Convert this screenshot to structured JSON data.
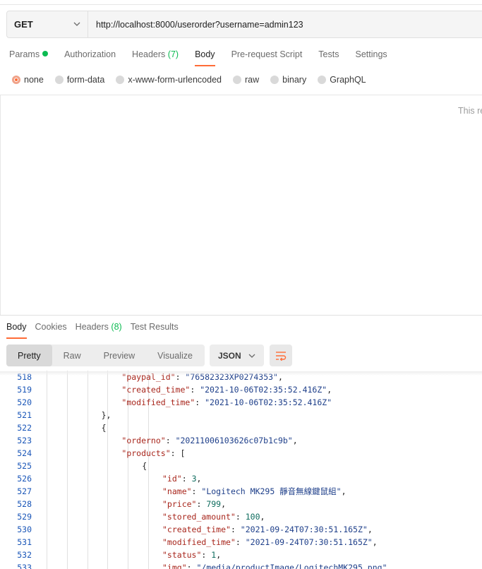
{
  "request": {
    "method": "GET",
    "url": "http://localhost:8000/userorder?username=admin123"
  },
  "request_tabs": [
    {
      "label": "Params",
      "dot": true
    },
    {
      "label": "Authorization"
    },
    {
      "label": "Headers",
      "count": "(7)"
    },
    {
      "label": "Body",
      "active": true
    },
    {
      "label": "Pre-request Script"
    },
    {
      "label": "Tests"
    },
    {
      "label": "Settings"
    }
  ],
  "body_types": [
    "none",
    "form-data",
    "x-www-form-urlencoded",
    "raw",
    "binary",
    "GraphQL"
  ],
  "selected_body_type": "none",
  "body_hint": "This re",
  "response_tabs": [
    {
      "label": "Body",
      "active": true
    },
    {
      "label": "Cookies"
    },
    {
      "label": "Headers",
      "count": "(8)"
    },
    {
      "label": "Test Results"
    }
  ],
  "view_modes": [
    "Pretty",
    "Raw",
    "Preview",
    "Visualize"
  ],
  "active_view": "Pretty",
  "format": "JSON",
  "colors": {
    "accent": "#ff6c37",
    "success": "#0cbb52",
    "key": "#a8261c",
    "string": "#1e3f8a",
    "number": "#0f6d5f",
    "line_number": "#1a56b8"
  },
  "code_lines": [
    {
      "n": "518",
      "indent": 4,
      "tokens": [
        [
          "k",
          "\"paypal_id\""
        ],
        [
          "p",
          ": "
        ],
        [
          "s",
          "\"76582323XP0274353\""
        ],
        [
          "p",
          ","
        ]
      ]
    },
    {
      "n": "519",
      "indent": 4,
      "tokens": [
        [
          "k",
          "\"created_time\""
        ],
        [
          "p",
          ": "
        ],
        [
          "s",
          "\"2021-10-06T02:35:52.416Z\""
        ],
        [
          "p",
          ","
        ]
      ]
    },
    {
      "n": "520",
      "indent": 4,
      "tokens": [
        [
          "k",
          "\"modified_time\""
        ],
        [
          "p",
          ": "
        ],
        [
          "s",
          "\"2021-10-06T02:35:52.416Z\""
        ]
      ]
    },
    {
      "n": "521",
      "indent": 3,
      "tokens": [
        [
          "p",
          "},"
        ]
      ]
    },
    {
      "n": "522",
      "indent": 3,
      "tokens": [
        [
          "p",
          "{"
        ]
      ]
    },
    {
      "n": "523",
      "indent": 4,
      "tokens": [
        [
          "k",
          "\"orderno\""
        ],
        [
          "p",
          ": "
        ],
        [
          "s",
          "\"20211006103626c07b1c9b\""
        ],
        [
          "p",
          ","
        ]
      ]
    },
    {
      "n": "524",
      "indent": 4,
      "tokens": [
        [
          "k",
          "\"products\""
        ],
        [
          "p",
          ": ["
        ]
      ]
    },
    {
      "n": "525",
      "indent": 5,
      "tokens": [
        [
          "p",
          "{"
        ]
      ]
    },
    {
      "n": "526",
      "indent": 6,
      "tokens": [
        [
          "k",
          "\"id\""
        ],
        [
          "p",
          ": "
        ],
        [
          "n",
          "3"
        ],
        [
          "p",
          ","
        ]
      ]
    },
    {
      "n": "527",
      "indent": 6,
      "tokens": [
        [
          "k",
          "\"name\""
        ],
        [
          "p",
          ": "
        ],
        [
          "s",
          "\"Logitech MK295 靜音無線鍵鼠組\""
        ],
        [
          "p",
          ","
        ]
      ]
    },
    {
      "n": "528",
      "indent": 6,
      "tokens": [
        [
          "k",
          "\"price\""
        ],
        [
          "p",
          ": "
        ],
        [
          "n",
          "799"
        ],
        [
          "p",
          ","
        ]
      ]
    },
    {
      "n": "529",
      "indent": 6,
      "tokens": [
        [
          "k",
          "\"stored_amount\""
        ],
        [
          "p",
          ": "
        ],
        [
          "n",
          "100"
        ],
        [
          "p",
          ","
        ]
      ]
    },
    {
      "n": "530",
      "indent": 6,
      "tokens": [
        [
          "k",
          "\"created_time\""
        ],
        [
          "p",
          ": "
        ],
        [
          "s",
          "\"2021-09-24T07:30:51.165Z\""
        ],
        [
          "p",
          ","
        ]
      ]
    },
    {
      "n": "531",
      "indent": 6,
      "tokens": [
        [
          "k",
          "\"modified_time\""
        ],
        [
          "p",
          ": "
        ],
        [
          "s",
          "\"2021-09-24T07:30:51.165Z\""
        ],
        [
          "p",
          ","
        ]
      ]
    },
    {
      "n": "532",
      "indent": 6,
      "tokens": [
        [
          "k",
          "\"status\""
        ],
        [
          "p",
          ": "
        ],
        [
          "n",
          "1"
        ],
        [
          "p",
          ","
        ]
      ]
    },
    {
      "n": "533",
      "indent": 6,
      "tokens": [
        [
          "k",
          "\"img\""
        ],
        [
          "p",
          ": "
        ],
        [
          "s",
          "\"/media/productImage/LogitechMK295.png\""
        ]
      ]
    }
  ]
}
